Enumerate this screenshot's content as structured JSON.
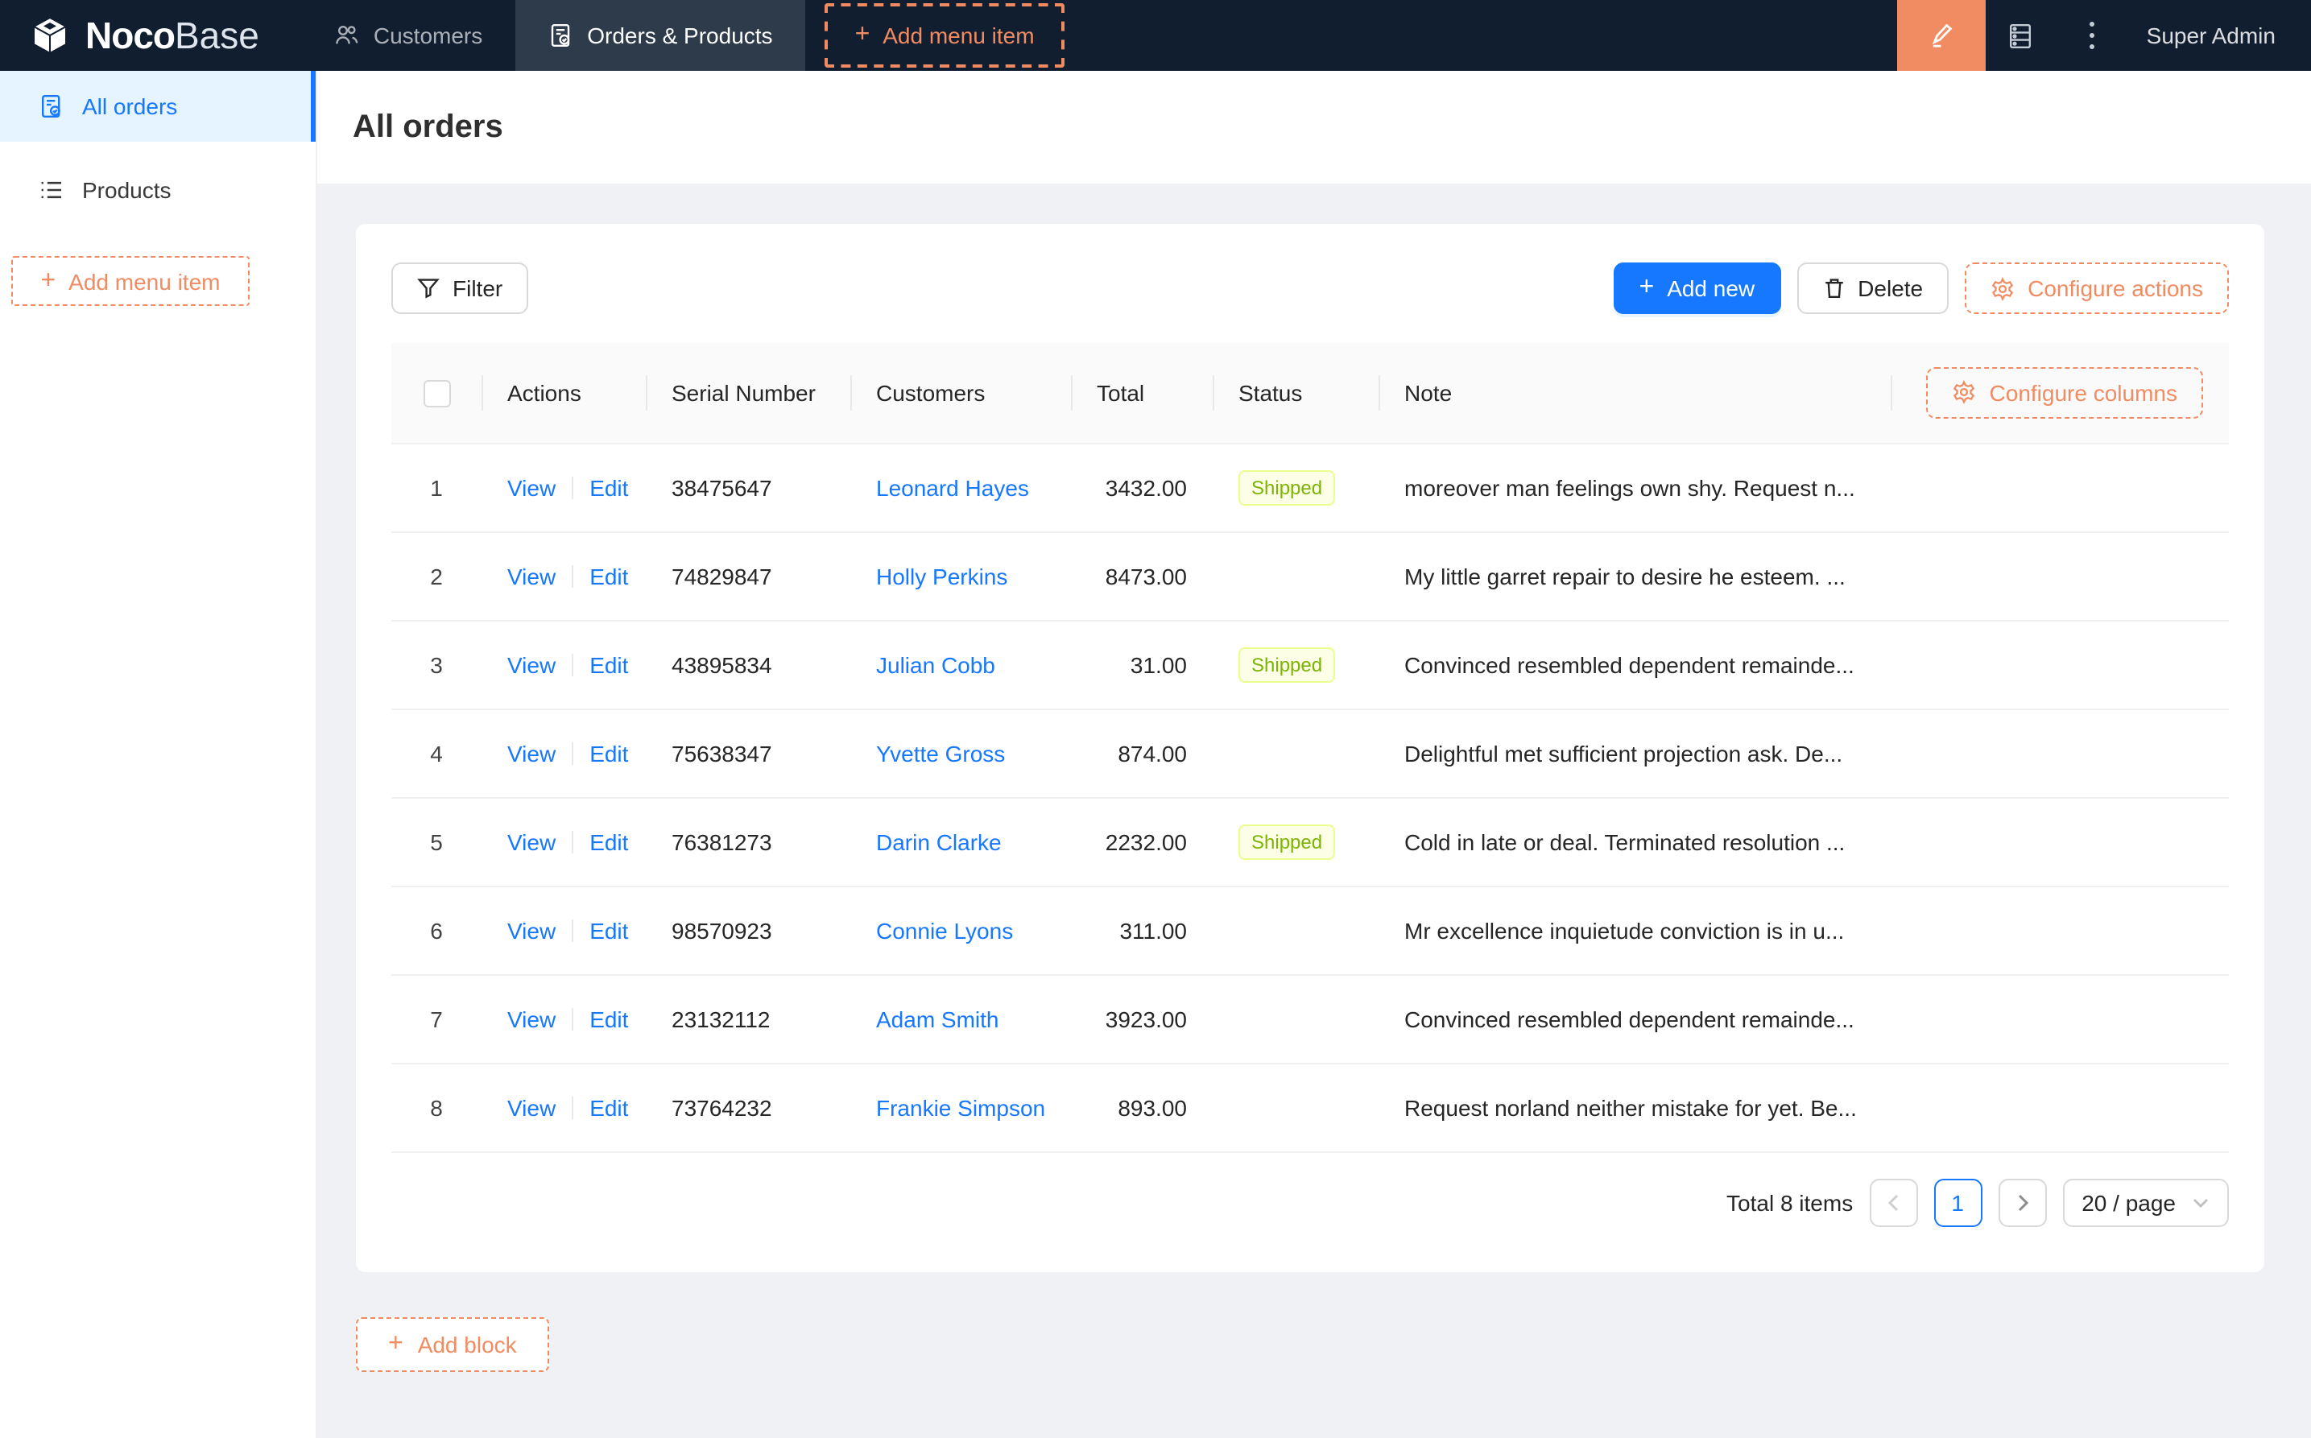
{
  "topbar": {
    "logo": {
      "part1": "Noco",
      "part2": "Base"
    },
    "nav": [
      {
        "label": "Customers",
        "active": false
      },
      {
        "label": "Orders & Products",
        "active": true
      }
    ],
    "add_menu_item_label": "Add menu item",
    "user": "Super Admin"
  },
  "sidebar": {
    "items": [
      {
        "label": "All orders",
        "active": true
      },
      {
        "label": "Products",
        "active": false
      }
    ],
    "add_menu_item_label": "Add menu item"
  },
  "page": {
    "title": "All orders"
  },
  "toolbar": {
    "filter_label": "Filter",
    "add_new_label": "Add new",
    "delete_label": "Delete",
    "configure_actions_label": "Configure actions"
  },
  "table": {
    "columns": [
      "Actions",
      "Serial Number",
      "Customers",
      "Total",
      "Status",
      "Note"
    ],
    "configure_columns_label": "Configure columns",
    "actions": {
      "view": "View",
      "edit": "Edit"
    },
    "rows": [
      {
        "index": "1",
        "serial": "38475647",
        "customer": "Leonard Hayes",
        "total": "3432.00",
        "status": "Shipped",
        "note": "moreover man feelings own shy. Request n..."
      },
      {
        "index": "2",
        "serial": "74829847",
        "customer": "Holly Perkins",
        "total": "8473.00",
        "status": "",
        "note": "My little garret repair to desire he esteem. ..."
      },
      {
        "index": "3",
        "serial": "43895834",
        "customer": "Julian Cobb",
        "total": "31.00",
        "status": "Shipped",
        "note": "Convinced resembled dependent remainde..."
      },
      {
        "index": "4",
        "serial": "75638347",
        "customer": "Yvette Gross",
        "total": "874.00",
        "status": "",
        "note": "Delightful met sufficient projection ask. De..."
      },
      {
        "index": "5",
        "serial": "76381273",
        "customer": "Darin Clarke",
        "total": "2232.00",
        "status": "Shipped",
        "note": "Cold in late or deal. Terminated resolution ..."
      },
      {
        "index": "6",
        "serial": "98570923",
        "customer": "Connie Lyons",
        "total": "311.00",
        "status": "",
        "note": "Mr excellence inquietude conviction is in u..."
      },
      {
        "index": "7",
        "serial": "23132112",
        "customer": "Adam Smith",
        "total": "3923.00",
        "status": "",
        "note": "Convinced resembled dependent remainde..."
      },
      {
        "index": "8",
        "serial": "73764232",
        "customer": "Frankie Simpson",
        "total": "893.00",
        "status": "",
        "note": "Request norland neither mistake for yet. Be..."
      }
    ]
  },
  "pagination": {
    "total_text": "Total 8 items",
    "current_page": "1",
    "page_size": "20 / page"
  },
  "add_block_label": "Add block",
  "colors": {
    "topbar_bg": "#101e30",
    "accent_blue": "#1677ff",
    "accent_orange": "#f18b62",
    "status_lime_bg": "#fcffe6",
    "status_lime_border": "#eaff8f",
    "status_lime_text": "#7cb305"
  }
}
